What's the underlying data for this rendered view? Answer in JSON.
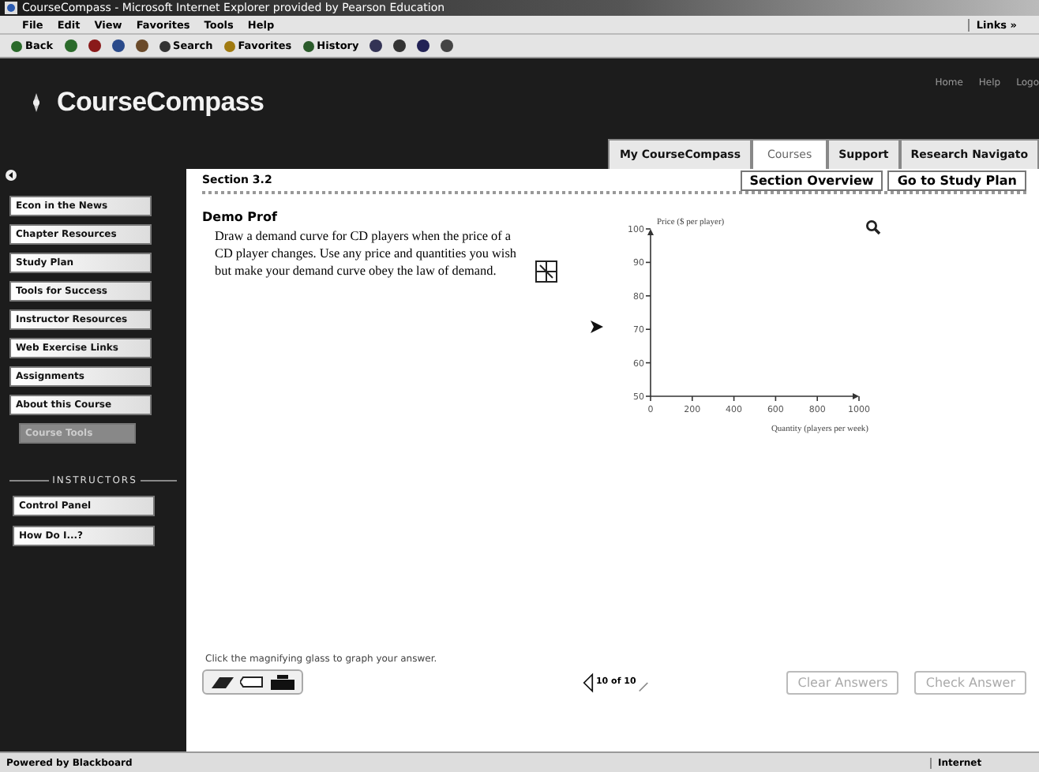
{
  "window": {
    "title": "CourseCompass - Microsoft Internet Explorer provided by Pearson Education"
  },
  "menu": [
    "File",
    "Edit",
    "View",
    "Favorites",
    "Tools",
    "Help"
  ],
  "links_label": "Links »",
  "toolbar": [
    {
      "kind": "back",
      "label": "Back"
    },
    {
      "kind": "forward"
    },
    {
      "kind": "stop"
    },
    {
      "kind": "refresh"
    },
    {
      "kind": "home"
    },
    {
      "kind": "search",
      "label": "Search"
    },
    {
      "kind": "favorites",
      "label": "Favorites"
    },
    {
      "kind": "history",
      "label": "History"
    },
    {
      "kind": "mail"
    },
    {
      "kind": "print"
    },
    {
      "kind": "edit"
    },
    {
      "kind": "discuss"
    }
  ],
  "site": {
    "logo": "CourseCompass",
    "top_links": [
      "Home",
      "Help",
      "Logo"
    ],
    "tabs": [
      {
        "label": "My CourseCompass",
        "selected": false
      },
      {
        "label": "Courses",
        "selected": true
      },
      {
        "label": "Support",
        "selected": false
      },
      {
        "label": "Research Navigato",
        "selected": false
      }
    ]
  },
  "sidebar": {
    "items": [
      {
        "label": "Econ in the News",
        "disabled": false
      },
      {
        "label": "Chapter Resources",
        "disabled": false
      },
      {
        "label": "Study Plan",
        "disabled": false
      },
      {
        "label": "Tools for Success",
        "disabled": false
      },
      {
        "label": "Instructor Resources",
        "disabled": false
      },
      {
        "label": "Web Exercise Links",
        "disabled": false
      },
      {
        "label": "Assignments",
        "disabled": false
      },
      {
        "label": "About this Course",
        "disabled": false
      },
      {
        "label": "Course Tools",
        "disabled": true
      }
    ],
    "section_title": "INSTRUCTORS",
    "instructor_items": [
      {
        "label": "Control Panel"
      },
      {
        "label": "How Do I...?"
      }
    ]
  },
  "content": {
    "section": "Section 3.2",
    "section_buttons": [
      "Section Overview",
      "Go to Study Plan"
    ],
    "author": "Demo Prof",
    "question": "Draw a demand curve for CD players when the price of a CD player changes.  Use any price and quantities you wish but make your demand curve obey the law of demand.",
    "chart_data": {
      "type": "line",
      "ylabel": "Price ($ per player)",
      "xlabel": "Quantity (players per week)",
      "xlim": [
        0,
        1000
      ],
      "ylim": [
        50,
        100
      ],
      "xticks": [
        0,
        200,
        400,
        600,
        800,
        1000
      ],
      "yticks": [
        50,
        60,
        70,
        80,
        90,
        100
      ]
    },
    "hint": "Click the magnifying glass to graph your answer.",
    "pager": "10 of 10",
    "buttons": [
      {
        "label": "Clear Answers",
        "disabled": true
      },
      {
        "label": "Check Answer",
        "disabled": true
      }
    ]
  },
  "status_bar": {
    "left": "Powered by Blackboard",
    "zone": "Internet"
  }
}
